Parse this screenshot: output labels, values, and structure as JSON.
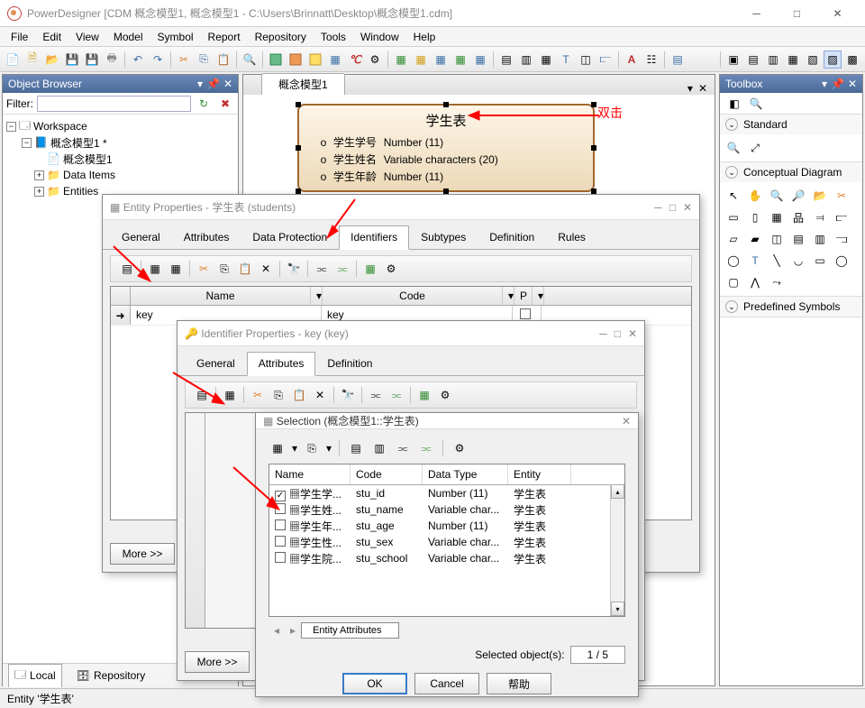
{
  "window": {
    "title": "PowerDesigner [CDM 概念模型1, 概念模型1 - C:\\Users\\Brinnatt\\Desktop\\概念模型1.cdm]"
  },
  "menu": [
    "File",
    "Edit",
    "View",
    "Model",
    "Symbol",
    "Report",
    "Repository",
    "Tools",
    "Window",
    "Help"
  ],
  "object_browser": {
    "title": "Object Browser",
    "filter_label": "Filter:",
    "filter_value": "",
    "tree": {
      "root": "Workspace",
      "model": "概念模型1 *",
      "diagram": "概念模型1",
      "items": [
        "Data Items",
        "Entities"
      ]
    },
    "tabs": {
      "local": "Local",
      "repository": "Repository"
    }
  },
  "canvas": {
    "tab": "概念模型1",
    "entity": {
      "title": "学生表",
      "attrs": [
        {
          "name": "学生学号",
          "type": "Number (11)"
        },
        {
          "name": "学生姓名",
          "type": "Variable characters (20)"
        },
        {
          "name": "学生年龄",
          "type": "Number (11)"
        }
      ]
    },
    "annotation": "双击"
  },
  "toolbox": {
    "title": "Toolbox",
    "sections": {
      "standard": "Standard",
      "conceptual": "Conceptual Diagram",
      "predefined": "Predefined Symbols"
    }
  },
  "entity_dialog": {
    "title": "Entity Properties - 学生表 (students)",
    "tabs": [
      "General",
      "Attributes",
      "Data Protection",
      "Identifiers",
      "Subtypes",
      "Definition",
      "Rules"
    ],
    "active_tab": "Identifiers",
    "grid": {
      "headers": {
        "name": "Name",
        "code": "Code",
        "p": "P"
      },
      "rows": [
        {
          "name": "key",
          "code": "key",
          "p": false
        }
      ]
    },
    "more_btn": "More >>"
  },
  "identifier_dialog": {
    "title": "Identifier Properties - key (key)",
    "tabs": [
      "General",
      "Attributes",
      "Definition"
    ],
    "active_tab": "Attributes",
    "more_btn": "More >>"
  },
  "selection_dialog": {
    "title": "Selection (概念模型1::学生表)",
    "headers": {
      "name": "Name",
      "code": "Code",
      "type": "Data Type",
      "entity": "Entity"
    },
    "rows": [
      {
        "checked": true,
        "name": "学生学...",
        "code": "stu_id",
        "type": "Number (11)",
        "entity": "学生表"
      },
      {
        "checked": false,
        "name": "学生姓...",
        "code": "stu_name",
        "type": "Variable char...",
        "entity": "学生表"
      },
      {
        "checked": false,
        "name": "学生年...",
        "code": "stu_age",
        "type": "Number (11)",
        "entity": "学生表"
      },
      {
        "checked": false,
        "name": "学生性...",
        "code": "stu_sex",
        "type": "Variable char...",
        "entity": "学生表"
      },
      {
        "checked": false,
        "name": "学生院...",
        "code": "stu_school",
        "type": "Variable char...",
        "entity": "学生表"
      }
    ],
    "attr_tab": "Entity Attributes",
    "selected_label": "Selected object(s):",
    "selected_count": "1 / 5",
    "buttons": {
      "ok": "OK",
      "cancel": "Cancel",
      "help": "帮助"
    }
  },
  "status": "Entity '学生表'"
}
